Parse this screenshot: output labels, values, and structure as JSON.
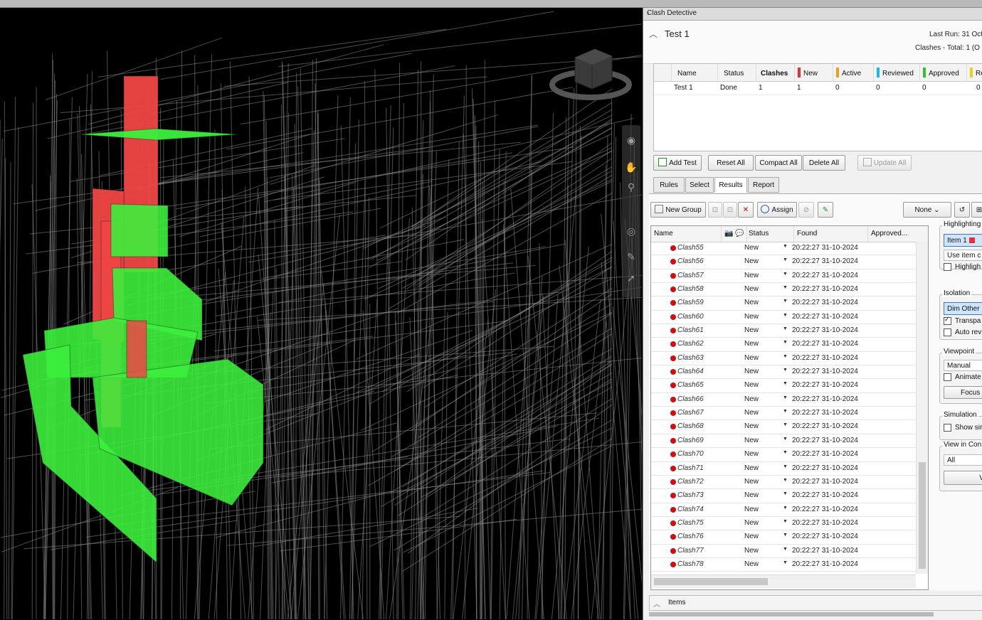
{
  "panel": {
    "title": "Clash Detective",
    "pin_glyph": "ᵥ",
    "test_name": "Test 1",
    "last_run": "Last Run:  31 Oct",
    "clash_summary": "Clashes -  Total:  1  (O"
  },
  "test_table": {
    "headers": [
      "Name",
      "Status",
      "Clashes",
      "New",
      "Active",
      "Reviewed",
      "Approved",
      "Re"
    ],
    "colors": {
      "new": "#e53030",
      "active": "#f0a020",
      "reviewed": "#20b8e0",
      "approved": "#30c030",
      "resolved": "#e8d020"
    },
    "row": [
      "Test 1",
      "Done",
      "1",
      "1",
      "0",
      "0",
      "0",
      "0"
    ]
  },
  "toolbar": {
    "add_test": "Add Test",
    "reset_all": "Reset All",
    "compact_all": "Compact All",
    "delete_all": "Delete All",
    "update_all": "Update All"
  },
  "tabs": [
    "Rules",
    "Select",
    "Results",
    "Report"
  ],
  "results_toolbar": {
    "new_group": "New Group",
    "assign": "Assign",
    "none": "None"
  },
  "results_headers": {
    "name": "Name",
    "status": "Status",
    "found": "Found",
    "approved": "Approved..."
  },
  "results": [
    {
      "name": "Clash55",
      "status": "New",
      "found": "20:22:27 31-10-2024"
    },
    {
      "name": "Clash56",
      "status": "New",
      "found": "20:22:27 31-10-2024"
    },
    {
      "name": "Clash57",
      "status": "New",
      "found": "20:22:27 31-10-2024"
    },
    {
      "name": "Clash58",
      "status": "New",
      "found": "20:22:27 31-10-2024"
    },
    {
      "name": "Clash59",
      "status": "New",
      "found": "20:22:27 31-10-2024"
    },
    {
      "name": "Clash60",
      "status": "New",
      "found": "20:22:27 31-10-2024"
    },
    {
      "name": "Clash61",
      "status": "New",
      "found": "20:22:27 31-10-2024"
    },
    {
      "name": "Clash62",
      "status": "New",
      "found": "20:22:27 31-10-2024"
    },
    {
      "name": "Clash63",
      "status": "New",
      "found": "20:22:27 31-10-2024"
    },
    {
      "name": "Clash64",
      "status": "New",
      "found": "20:22:27 31-10-2024"
    },
    {
      "name": "Clash65",
      "status": "New",
      "found": "20:22:27 31-10-2024"
    },
    {
      "name": "Clash66",
      "status": "New",
      "found": "20:22:27 31-10-2024"
    },
    {
      "name": "Clash67",
      "status": "New",
      "found": "20:22:27 31-10-2024"
    },
    {
      "name": "Clash68",
      "status": "New",
      "found": "20:22:27 31-10-2024"
    },
    {
      "name": "Clash69",
      "status": "New",
      "found": "20:22:27 31-10-2024"
    },
    {
      "name": "Clash70",
      "status": "New",
      "found": "20:22:27 31-10-2024"
    },
    {
      "name": "Clash71",
      "status": "New",
      "found": "20:22:27 31-10-2024"
    },
    {
      "name": "Clash72",
      "status": "New",
      "found": "20:22:27 31-10-2024"
    },
    {
      "name": "Clash73",
      "status": "New",
      "found": "20:22:27 31-10-2024"
    },
    {
      "name": "Clash74",
      "status": "New",
      "found": "20:22:27 31-10-2024"
    },
    {
      "name": "Clash75",
      "status": "New",
      "found": "20:22:27 31-10-2024"
    },
    {
      "name": "Clash76",
      "status": "New",
      "found": "20:22:27 31-10-2024"
    },
    {
      "name": "Clash77",
      "status": "New",
      "found": "20:22:27 31-10-2024"
    },
    {
      "name": "Clash78",
      "status": "New",
      "found": "20:22:27 31-10-2024"
    }
  ],
  "side": {
    "highlighting": "Highlighting",
    "item1": "Item 1",
    "use_item": "Use item c",
    "highlight": "Highligh",
    "isolation": "Isolation",
    "dim_other": "Dim Other",
    "transparent": "Transpa",
    "auto_reveal": "Auto rev",
    "viewpoint": "Viewpoint",
    "manual": "Manual",
    "animate": "Animate",
    "focus": "Focus c",
    "simulation": "Simulation",
    "show_sim": "Show sir",
    "view_in_context": "View in Con",
    "all": "All",
    "view_btn": "Vi"
  },
  "items_section": "Items"
}
